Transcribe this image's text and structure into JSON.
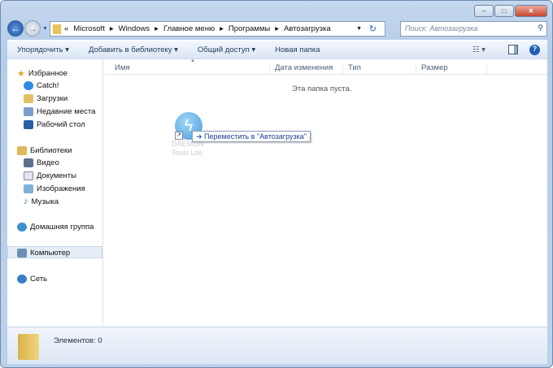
{
  "window": {
    "minimize": "‒",
    "maximize": "□",
    "close": "✕"
  },
  "address": {
    "overflow": "«",
    "crumbs": [
      "Microsoft",
      "Windows",
      "Главное меню",
      "Программы",
      "Автозагрузка"
    ]
  },
  "search": {
    "placeholder": "Поиск: Автозагрузка"
  },
  "toolbar": {
    "organize": "Упорядочить ▾",
    "add_library": "Добавить в библиотеку ▾",
    "share": "Общий доступ ▾",
    "new_folder": "Новая папка"
  },
  "nav": {
    "favorites": "Избранное",
    "catch": "Catch!",
    "downloads": "Загрузки",
    "recent": "Недавние места",
    "desktop": "Рабочий стол",
    "libraries": "Библиотеки",
    "video": "Видео",
    "documents": "Документы",
    "images": "Изображения",
    "music": "Музыка",
    "homegroup": "Домашняя группа",
    "computer": "Компьютер",
    "network": "Сеть"
  },
  "columns": {
    "name": "Имя",
    "date": "Дата изменения",
    "type": "Тип",
    "size": "Размер"
  },
  "empty_text": "Эта папка пуста.",
  "drag": {
    "icon_label": "DAEMON Tools Lite",
    "tooltip": "Переместить в \"Автозагрузка\""
  },
  "status": {
    "items": "Элементов: 0"
  }
}
